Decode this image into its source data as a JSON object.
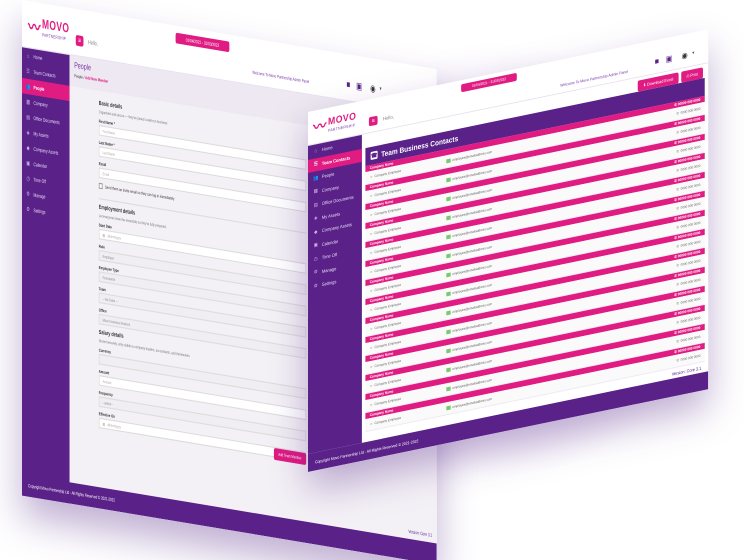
{
  "brand": {
    "name": "MOVO",
    "tagline": "PARTNERSHIP",
    "colors": {
      "primary": "#5a2189",
      "accent": "#e01b82"
    }
  },
  "back_window": {
    "topbar": {
      "hello": "Hello,",
      "date_range": "01/04/2021 - 31/03/2022",
      "welcome": "Welcome To Movo Partnership Admin Panel"
    },
    "sidebar": [
      {
        "icon": "home-icon",
        "glyph": "⌂",
        "label": "Home"
      },
      {
        "icon": "contacts-icon",
        "glyph": "☰",
        "label": "Team Contacts"
      },
      {
        "icon": "people-icon",
        "glyph": "👥",
        "label": "People",
        "active": true
      },
      {
        "icon": "company-icon",
        "glyph": "▦",
        "label": "Company"
      },
      {
        "icon": "documents-icon",
        "glyph": "▤",
        "label": "Office Documents"
      },
      {
        "icon": "assets-icon",
        "glyph": "◈",
        "label": "My Assets"
      },
      {
        "icon": "company-assets-icon",
        "glyph": "◆",
        "label": "Company Assets"
      },
      {
        "icon": "calendar-icon",
        "glyph": "▣",
        "label": "Calendar"
      },
      {
        "icon": "time-off-icon",
        "glyph": "◷",
        "label": "Time Off"
      },
      {
        "icon": "manage-icon",
        "glyph": "⚙",
        "label": "Manage"
      },
      {
        "icon": "settings-icon",
        "glyph": "⚙",
        "label": "Settings"
      }
    ],
    "page": {
      "title": "People",
      "breadcrumb_root": "People",
      "breadcrumb_current": "Add New Member"
    },
    "form": {
      "basic_title": "Basic details",
      "basic_sub": "Organised and secure — they've joined a well-run business",
      "first_name_label": "First Name *",
      "first_name_placeholder": "First Name",
      "last_name_label": "Last Name *",
      "last_name_placeholder": "Last Name",
      "email_label": "Email",
      "email_placeholder": "Email",
      "invite_label": "Send them an invite email so they can log in immediately",
      "employment_title": "Employment details",
      "employment_sub": "Let everyone know the essentials so they're fully prepared.",
      "start_date_label": "Start Date",
      "start_date_placeholder": "dd/mm/yyyy",
      "role_label": "Role",
      "role_value": "Employee",
      "employee_type_label": "Employee Type",
      "employee_type_value": "Permanent",
      "team_label": "Team",
      "team_value": "-- No Team --",
      "office_label": "Office",
      "office_value": "Movo Insurance Brokers",
      "salary_title": "Salary details",
      "salary_sub": "Stored securely, only visible to company leaders, accountants, and themselves.",
      "currency_label": "Currency",
      "amount_label": "Amount",
      "amount_placeholder": "Amount",
      "frequency_label": "Frequency",
      "frequency_value": "--select--",
      "effective_label": "Effective On",
      "effective_placeholder": "dd/mm/yyyy",
      "submit_label": "Add Team Member"
    },
    "version": "Version: Core 3.1",
    "copyright": "Copyright Movo Partnership Ltd - All Rights Reserved © 2021-2022"
  },
  "front_window": {
    "topbar": {
      "hello": "Hello,",
      "date_range": "01/04/2021 - 31/03/2022",
      "welcome": "Welcome To Movo Partnership Admin Panel"
    },
    "sidebar": [
      {
        "icon": "home-icon",
        "glyph": "⌂",
        "label": "Home"
      },
      {
        "icon": "contacts-icon",
        "glyph": "☰",
        "label": "Team Contacts",
        "active": true
      },
      {
        "icon": "people-icon",
        "glyph": "👥",
        "label": "People"
      },
      {
        "icon": "company-icon",
        "glyph": "▦",
        "label": "Company"
      },
      {
        "icon": "documents-icon",
        "glyph": "▤",
        "label": "Office Documents"
      },
      {
        "icon": "assets-icon",
        "glyph": "◈",
        "label": "My Assets"
      },
      {
        "icon": "company-assets-icon",
        "glyph": "◆",
        "label": "Company Assets"
      },
      {
        "icon": "calendar-icon",
        "glyph": "▣",
        "label": "Calendar"
      },
      {
        "icon": "time-off-icon",
        "glyph": "◷",
        "label": "Time Off"
      },
      {
        "icon": "manage-icon",
        "glyph": "⚙",
        "label": "Manage"
      },
      {
        "icon": "settings-icon",
        "glyph": "⚙",
        "label": "Settings"
      }
    ],
    "actions": {
      "download_label": "Download Excel",
      "print_label": "Print"
    },
    "heading": "Team Business Contacts",
    "top_phone": "0000 000 0000",
    "contacts": [
      {
        "name": "Company Name",
        "phone": "00000 000 0000",
        "role": "Company Employee",
        "email": "employee@emailaddress.com",
        "landline": "0000 000 0000"
      },
      {
        "name": "Company Name",
        "phone": "00000 000 0000",
        "role": "Company Employee",
        "email": "employee@emailaddress.com",
        "landline": "0000 000 0000"
      },
      {
        "name": "Company Name",
        "phone": "00000 000 0000",
        "role": "Company Employee",
        "email": "employee@emailaddress.com",
        "landline": "0000 000 0000"
      },
      {
        "name": "Company Name",
        "phone": "00000 000 0000",
        "role": "Company Employee",
        "email": "employee@emailaddress.com",
        "landline": "0000 000 0000"
      },
      {
        "name": "Company Name",
        "phone": "00000 000 0000",
        "role": "Company Employee",
        "email": "employee@emailaddress.com",
        "landline": "0000 000 0000"
      },
      {
        "name": "Company Name",
        "phone": "00000 000 0000",
        "role": "Company Employee",
        "email": "employee@emailaddress.com",
        "landline": "0000 000 0000"
      },
      {
        "name": "Company Name",
        "phone": "00000 000 0000",
        "role": "Company Employee",
        "email": "employee@emailaddress.com",
        "landline": "0000 000 0000"
      },
      {
        "name": "Company Name",
        "phone": "00000 000 0000",
        "role": "Company Employee",
        "email": "employee@emailaddress.com",
        "landline": "0000 000 0000"
      },
      {
        "name": "Company Name",
        "phone": "00000 000 0000",
        "role": "Company Employee",
        "email": "employee@emailaddress.com",
        "landline": "0000 000 0000"
      },
      {
        "name": "Company Name",
        "phone": "00000 000 0000",
        "role": "Company Employee",
        "email": "employee@emailaddress.com",
        "landline": "0000 000 0000"
      },
      {
        "name": "Company Name",
        "phone": "00000 000 0000",
        "role": "Company Employee",
        "email": "employee@emailaddress.com",
        "landline": "0000 000 0000"
      },
      {
        "name": "Company Name",
        "phone": "00000 000 0000",
        "role": "Company Employee",
        "email": "employee@emailaddress.com",
        "landline": "0000 000 0000"
      },
      {
        "name": "Company Name",
        "phone": "00000 000 0000",
        "role": "Company Employee",
        "email": "employee@emailaddress.com",
        "landline": "0000 000 0000"
      },
      {
        "name": "Company Name",
        "phone": "00000 000 0000",
        "role": "Company Employee",
        "email": "employee@emailaddress.com",
        "landline": "0000 000 0000"
      }
    ],
    "version": "Version: Core 3.1",
    "copyright": "Copyright Movo Partnership Ltd - All Rights Reserved © 2021-2022"
  }
}
